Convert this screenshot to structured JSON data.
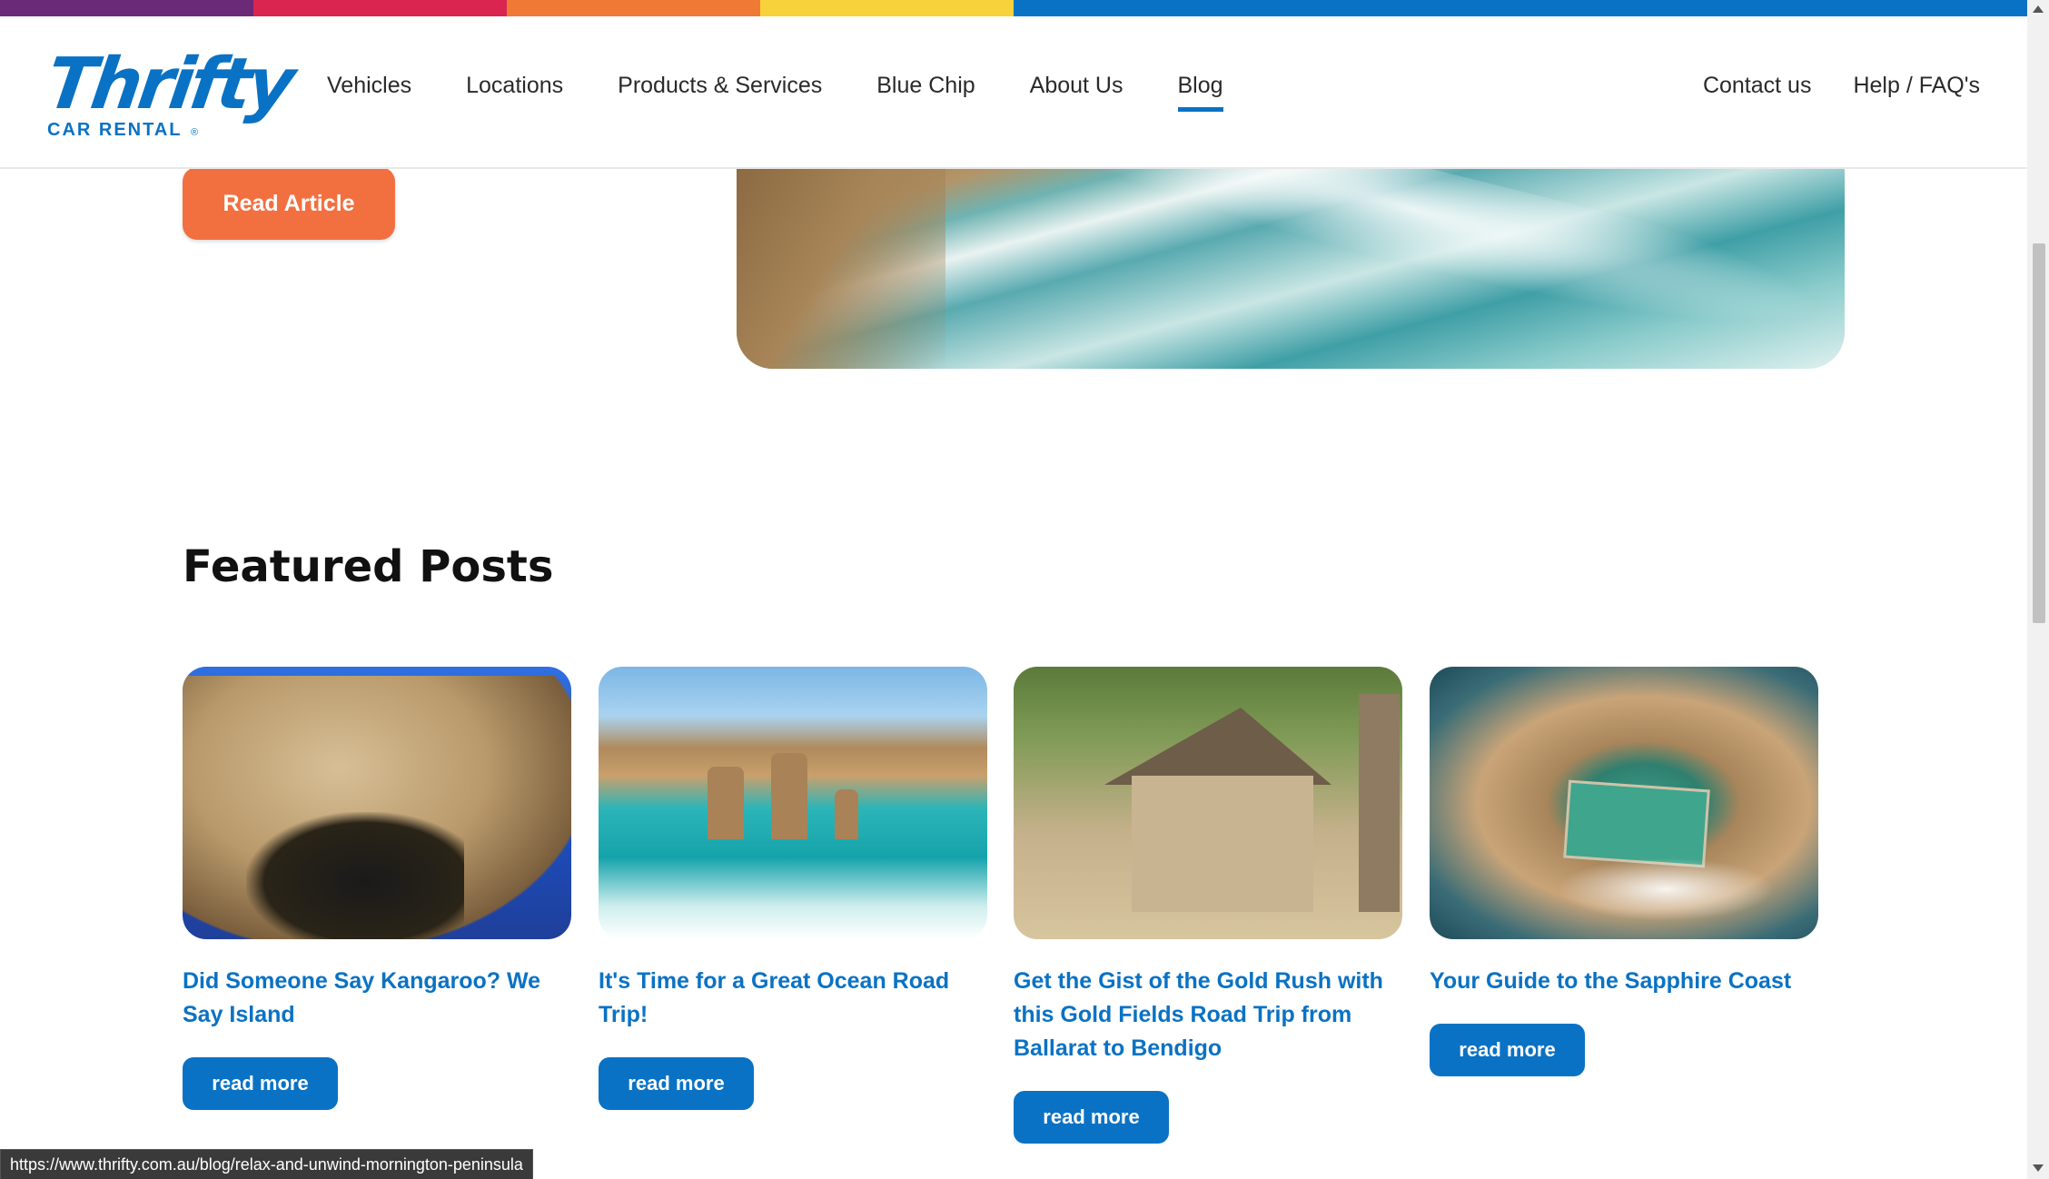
{
  "header": {
    "logo_word": "Thrifty",
    "logo_sub": "CAR RENTAL",
    "nav": [
      "Vehicles",
      "Locations",
      "Products & Services",
      "Blue Chip",
      "About Us",
      "Blog"
    ],
    "nav_active": "Blog",
    "nav_right": [
      "Contact us",
      "Help / FAQ's"
    ]
  },
  "hero": {
    "button_label": "Read Article"
  },
  "featured": {
    "title": "Featured Posts",
    "posts": [
      {
        "title": "Did Someone Say Kangaroo? We Say Island",
        "button": "read more"
      },
      {
        "title": "It's Time for a Great Ocean Road Trip!",
        "button": "read more"
      },
      {
        "title": "Get the Gist of the Gold Rush with this Gold Fields Road Trip from Ballarat to Bendigo",
        "button": "read more"
      },
      {
        "title": "Your Guide to the Sapphire Coast",
        "button": "read more"
      }
    ]
  },
  "status_bar": {
    "url": "https://www.thrifty.com.au/blog/relax-and-unwind-mornington-peninsula"
  },
  "colors": {
    "brand_blue": "#0a72c4",
    "accent_orange": "#f27040"
  }
}
